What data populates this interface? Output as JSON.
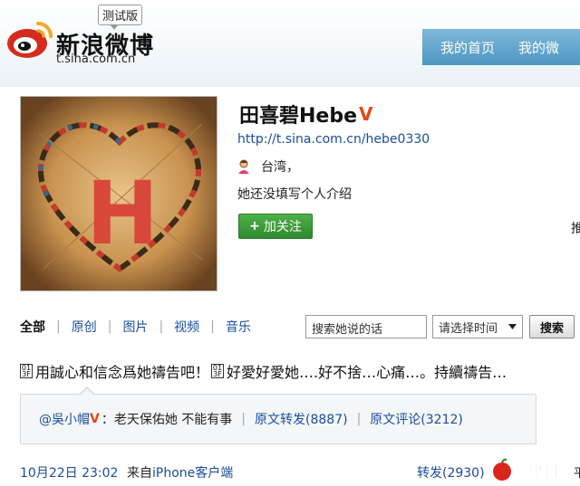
{
  "header": {
    "logo_text": "新浪微博",
    "logo_url": "t.sina.com.cn",
    "beta_label": "测试版",
    "nav": [
      {
        "label": "我的首页"
      },
      {
        "label": "我的微"
      }
    ]
  },
  "profile": {
    "name": "田喜碧Hebe",
    "verified_mark": "V",
    "url": "http://t.sina.com.cn/hebe0330",
    "location": "台湾，",
    "bio": "她还没填写个人介绍",
    "follow_label": "加关注",
    "edge_text": "推",
    "avatar_letter": "H"
  },
  "tabs": [
    {
      "label": "全部",
      "active": true
    },
    {
      "label": "原创",
      "active": false
    },
    {
      "label": "图片",
      "active": false
    },
    {
      "label": "视频",
      "active": false
    },
    {
      "label": "音乐",
      "active": false
    }
  ],
  "search": {
    "value": "搜索她说的话",
    "time_select": "请选择时间",
    "button_label": "搜索"
  },
  "post": {
    "text_part1": "用誠心和信念爲她禱告吧！",
    "text_part2": "好愛好愛她….好不捨…心痛…。持續禱告…",
    "repost": {
      "user": "@吳小帽",
      "verified_mark": "V",
      "content": "：老天保佑她 不能有事",
      "original_repost": "原文转发(8887)",
      "original_comment": "原文评论(3212)"
    },
    "time": "10月22日 23:02",
    "source_prefix": "来自",
    "source_link": "iPhone客户端",
    "repost_count": "转发(2930)"
  },
  "watermark": {
    "text": "蘋果日報",
    "edge_char": "平"
  },
  "colors": {
    "link": "#1a4d9a",
    "verified": "#e14a10",
    "follow_button": "#2f8a2d",
    "nav_bar": "#4d97c2",
    "watermark": "#d8261c"
  }
}
